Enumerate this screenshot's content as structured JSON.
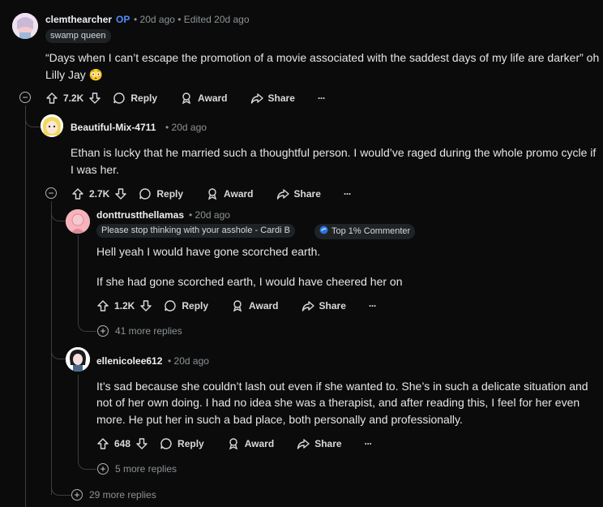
{
  "comments": {
    "op": {
      "author": "clemthearcher",
      "op_badge": "OP",
      "meta": "• 20d ago • Edited 20d ago",
      "flair": "swamp queen",
      "text_line1": "“Days when I can’t escape the promotion of a movie associated with the saddest days of my life are darker” oh",
      "text_line2": "Lilly Jay 😳",
      "votes": "7.2K"
    },
    "c1": {
      "author": "Beautiful-Mix-4711",
      "meta": "• 20d ago",
      "text_line1": "Ethan is lucky that he married such a thoughtful person. I would’ve raged during the whole promo cycle if",
      "text_line2": "I was her.",
      "votes": "2.7K"
    },
    "c2": {
      "author": "donttrustthellamas",
      "meta": "• 20d ago",
      "flair": "Please stop thinking with your asshole - Cardi B",
      "badge": "Top 1% Commenter",
      "text_line1": "Hell yeah I would have gone scorched earth.",
      "text_line2": "If she had gone scorched earth, I would have cheered her on",
      "votes": "1.2K",
      "more_replies": "41 more replies"
    },
    "c3": {
      "author": "ellenicolee612",
      "meta": "• 20d ago",
      "text_line1": "It’s sad because she couldn’t lash out even if she wanted to. She’s in such a delicate situation and",
      "text_line2": "not of her own doing. I had no idea she was a therapist, and after reading this, I feel for her even",
      "text_line3": "more. He put her in such a bad place, both personally and professionally.",
      "votes": "648",
      "more_replies": "5 more replies"
    },
    "c1_more_replies": "29 more replies"
  },
  "actions": {
    "reply": "Reply",
    "award": "Award",
    "share": "Share",
    "overflow": "···"
  },
  "colors": {
    "background": "#0b0b0b",
    "op_badge": "#4f8cff",
    "thread_line": "#3a3e41"
  }
}
